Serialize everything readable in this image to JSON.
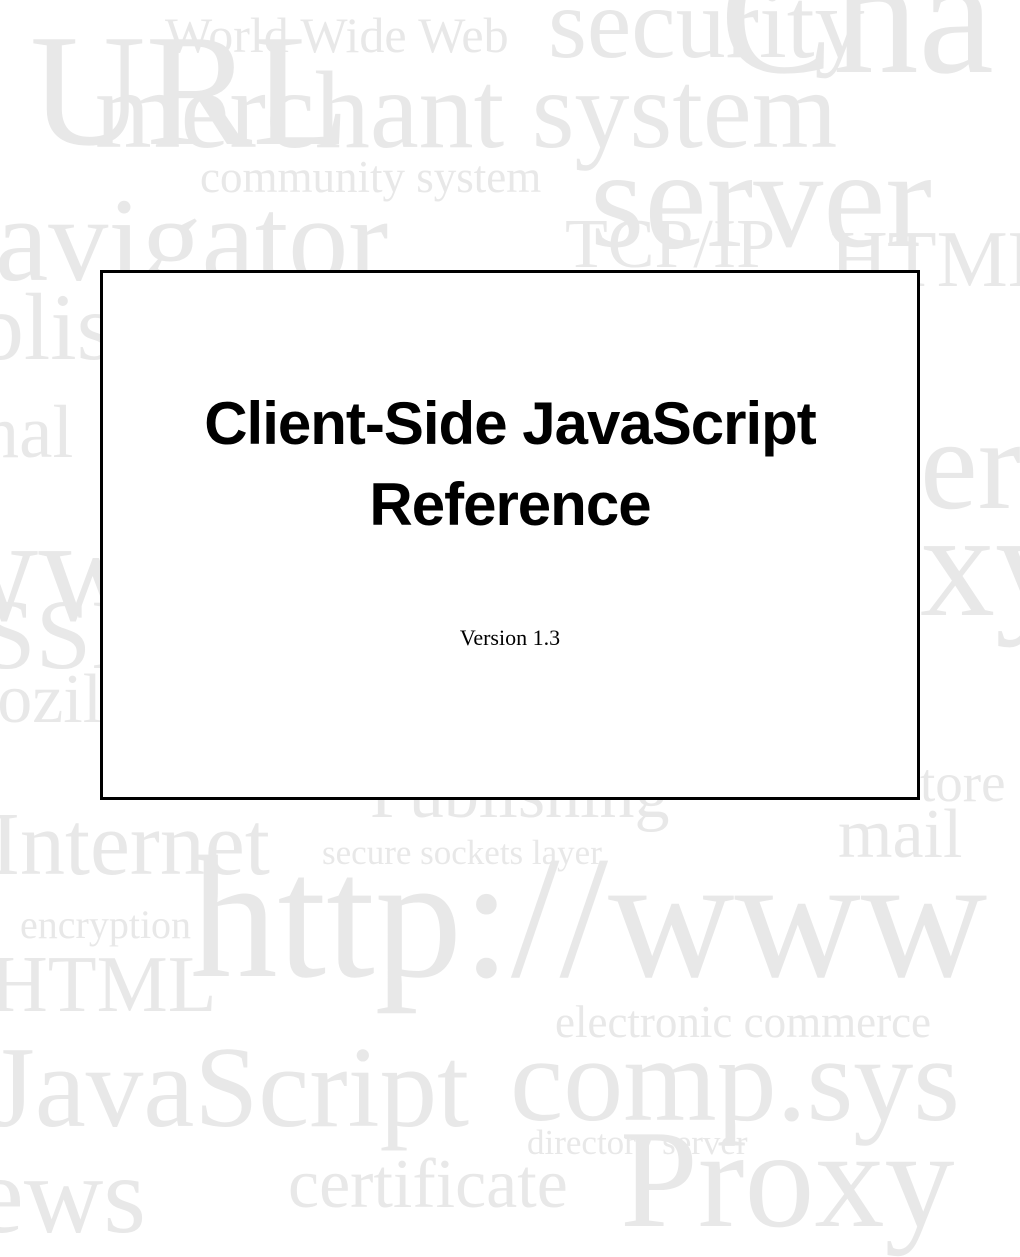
{
  "title_line1": "Client-Side JavaScript",
  "title_line2": "Reference",
  "version": "Version 1.3",
  "bg": {
    "world_wide_web": "World Wide Web",
    "security": "security",
    "cha": "Cha",
    "url": "URL",
    "merchant_system": "merchant system",
    "community_system": "community system",
    "server": "server",
    "navigator": "navigator",
    "tcpip": "TCP/IP",
    "html_top": "HTML",
    "iblis": "ıblis",
    "personal": "Personal",
    "er": "er",
    "ww": "ww",
    "xy": "xy",
    "ssl": "SSL",
    "mozilla": "Mozilla",
    "tore": "tore",
    "publishing": "Publishing",
    "mail": "mail",
    "internet": "Internet",
    "secure_sockets_layer": "secure sockets layer",
    "encryption": "encryption",
    "http_www": "http://www",
    "html_bottom": "HTML",
    "electronic_commerce": "electronic commerce",
    "javascript": "JavaScript",
    "comp_sys": "comp.sys",
    "directory_server": "directory server",
    "news": "news",
    "certificate": "certificate",
    "proxy": "Proxy"
  }
}
